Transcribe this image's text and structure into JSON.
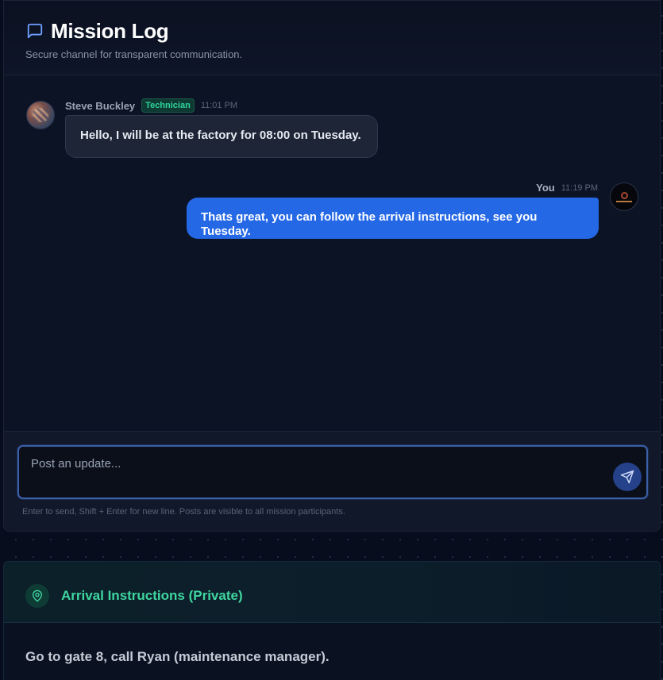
{
  "header": {
    "title": "Mission Log",
    "subtitle": "Secure channel for transparent communication.",
    "icon": "message-square-icon"
  },
  "messages": [
    {
      "sender": "Steve Buckley",
      "role": "Technician",
      "time": "11:01 PM",
      "text": "Hello, I will be at the factory for 08:00 on Tuesday.",
      "direction": "incoming"
    },
    {
      "sender": "You",
      "time": "11:19 PM",
      "text": "Thats great, you can follow the arrival instructions, see you Tuesday.",
      "direction": "outgoing"
    }
  ],
  "composer": {
    "placeholder": "Post an update...",
    "hint": "Enter to send, Shift + Enter for new line. Posts are visible to all mission participants.",
    "send_icon": "send-icon"
  },
  "arrival": {
    "title": "Arrival Instructions (Private)",
    "icon": "map-pin-icon",
    "body": "Go to gate 8, call Ryan (maintenance manager)."
  },
  "colors": {
    "accent_blue": "#2568e6",
    "accent_green": "#3fd6a0",
    "badge_green": "#2ed39a",
    "background": "#070d1c",
    "panel": "#0c1324"
  }
}
